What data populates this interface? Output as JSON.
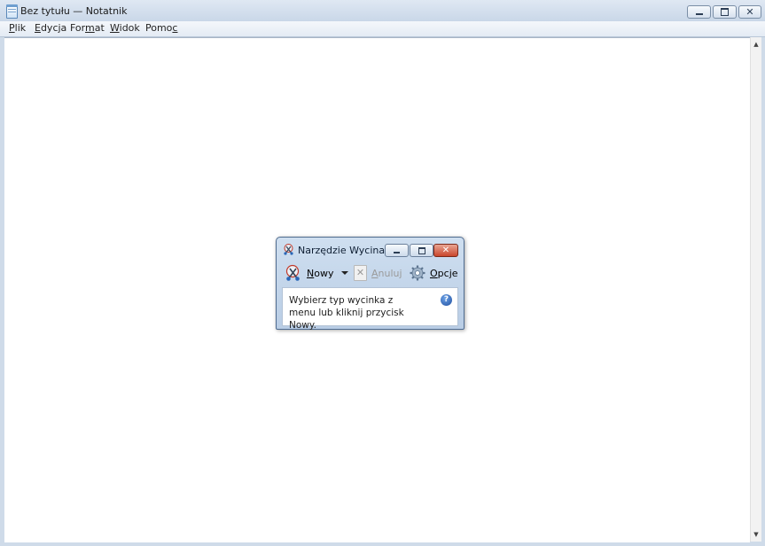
{
  "notepad": {
    "title": "Bez tytułu — Notatnik",
    "menu": [
      {
        "label": "Plik",
        "accel": "P",
        "rest": "lik"
      },
      {
        "label": "Edycja",
        "accel": "E",
        "rest": "dycja"
      },
      {
        "label": "Format",
        "pre": "For",
        "accel": "m",
        "rest": "at"
      },
      {
        "label": "Widok",
        "accel": "W",
        "rest": "idok"
      },
      {
        "label": "Pomoc",
        "pre": "Pomo",
        "accel": "c",
        "rest": ""
      }
    ],
    "content": "",
    "icons": {
      "app": "notepad-icon",
      "minimize": "minimize-icon",
      "maximize": "maximize-icon",
      "close": "close-icon"
    }
  },
  "snipping_tool": {
    "title": "Narzędzie Wycinanie",
    "toolbar": {
      "new_label": "Nowy",
      "new_accel": "N",
      "new_rest": "owy",
      "cancel_label": "Anuluj",
      "cancel_accel": "A",
      "cancel_rest": "nuluj",
      "options_label": "Opcje",
      "options_accel": "O",
      "options_rest": "pcje"
    },
    "message": "Wybierz typ wycinka z menu lub kliknij przycisk Nowy.",
    "icons": {
      "app": "scissors-icon",
      "new": "scissors-icon",
      "cancel": "cancel-icon",
      "options": "gear-icon",
      "help": "help-icon"
    }
  },
  "colors": {
    "close_button": "#c9462c",
    "window_frame": "#b9cde5",
    "help_icon": "#1f4e9e"
  }
}
